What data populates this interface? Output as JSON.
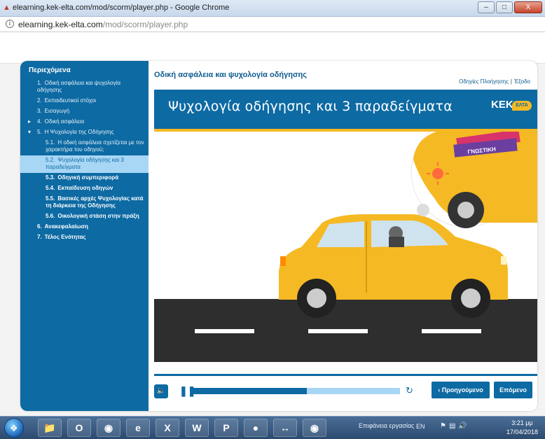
{
  "window": {
    "title": "elearning.kek-elta.com/mod/scorm/player.php - Google Chrome",
    "controls": [
      "–",
      "□",
      "X"
    ]
  },
  "address_bar": {
    "host": "elearning.kek-elta.com",
    "path": "/mod/scorm/player.php"
  },
  "sidebar": {
    "title": "Περιεχόμενα",
    "items": [
      {
        "num": "1.",
        "label": "Οδική ασφάλεια και ψυχολογία οδήγησης"
      },
      {
        "num": "2.",
        "label": "Εκπαιδευτικοί στόχοι"
      },
      {
        "num": "3.",
        "label": "Εισαγωγή"
      },
      {
        "num": "4.",
        "label": "Οδική ασφάλεια"
      },
      {
        "num": "5.",
        "label": "Η Ψυχολογία της Οδήγησης"
      }
    ],
    "subitems": [
      {
        "num": "5.1.",
        "label": "Η οδική ασφάλεια σχετίζεται με τον χαρακτήρα του οδηγού;"
      },
      {
        "num": "5.2.",
        "label": "Ψυχολογία οδήγησης και 3 παραδείγματα"
      },
      {
        "num": "5.3.",
        "label": "Οδηγική συμπεριφορά"
      },
      {
        "num": "5.4.",
        "label": "Εκπαίδευση οδηγών"
      },
      {
        "num": "5.5.",
        "label": "Βασικές αρχές Ψυχολογίας κατά τη διάρκεια της Οδήγησης"
      },
      {
        "num": "5.6.",
        "label": "Οικολογική στάση στην πράξη"
      }
    ],
    "tail_items": [
      {
        "num": "6.",
        "label": "Ανακεφαλαίωση"
      },
      {
        "num": "7.",
        "label": "Τέλος Ενότητας"
      }
    ]
  },
  "main": {
    "course_title": "Οδική ασφάλεια και ψυχολογία οδήγησης",
    "link_help": "Οδηγίες Πλοήγησης",
    "link_sep": "|",
    "link_exit": "Έξοδο",
    "slide_title": "Ψυχολογία οδήγησης και 3 παραδείγματα",
    "logo_main": "KEK",
    "logo_sub": "ΕΛΤΑ",
    "bubble_sign": "ΓΝΩΣΤΙΚΗ"
  },
  "controls": {
    "volume_icon": "speaker-icon",
    "pause_icon": "pause-icon",
    "progress": 0.55,
    "replay_icon": "replay-icon",
    "prev_label": "Προηγούμενο",
    "next_label": "Επόμενο"
  },
  "taskbar": {
    "tray_text": "Επιφάνεια εργασίας",
    "lang": "EN",
    "time": "3:21 μμ",
    "date": "17/04/2018"
  },
  "colors": {
    "brand_blue": "#0d6aa3",
    "accent_yellow": "#f5b923",
    "active_light_blue": "#a8d6f5"
  }
}
